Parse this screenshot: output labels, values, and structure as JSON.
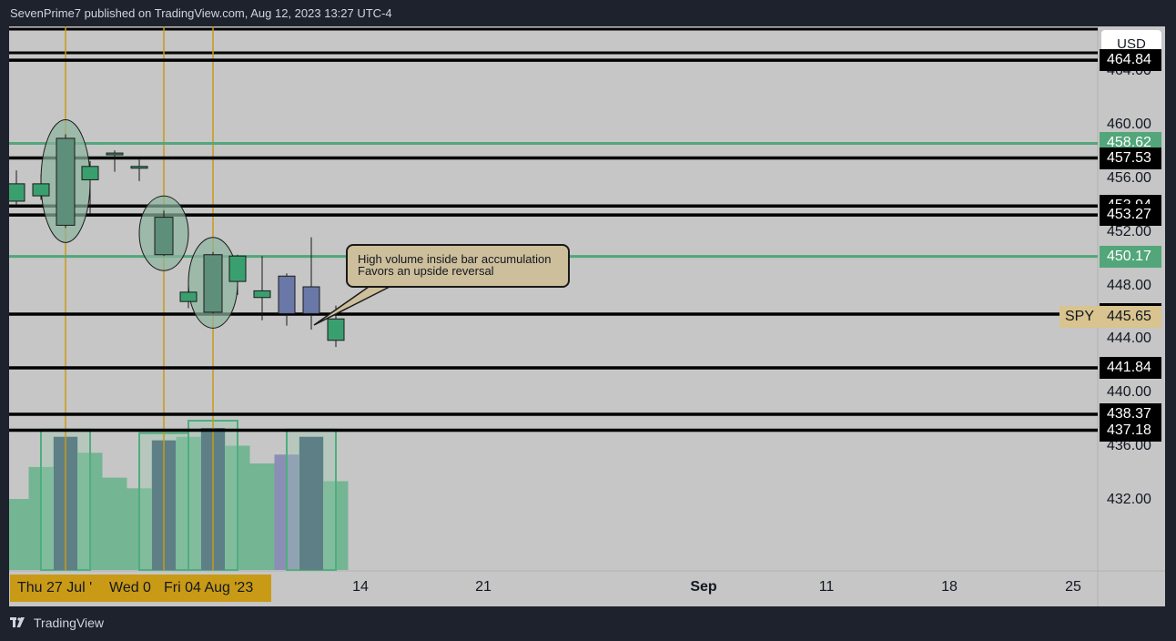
{
  "header": {
    "publisher_text": "SevenPrime7 published on TradingView.com, Aug 12, 2023 13:27 UTC-4"
  },
  "footer": {
    "brand": "TradingView",
    "logo_icon": "tradingview-logo-icon"
  },
  "toolbar": {
    "currency": "USD"
  },
  "annotation": {
    "line1": "High volume inside bar accumulation",
    "line2": "Favors an upside reversal"
  },
  "colors": {
    "background": "#c6c6c6",
    "up_candle": "#3a9f6e",
    "down_candle": "#6a78a8",
    "green_line": "#52a67a",
    "black_line": "#000000",
    "vertical_line": "#c99a16",
    "volume_up": "#5fb087",
    "volume_down": "#7c7fb0",
    "ellipse_fill": "#8cb49e",
    "symbol_tag": "#d9c48f",
    "date_badge": "#c99a16"
  },
  "chart_data": {
    "type": "candlestick",
    "symbol": "SPY",
    "currency": "USD",
    "ylim": [
      430,
      465.8
    ],
    "y_ticks": [
      "432.00",
      "436.00",
      "440.00",
      "444.00",
      "448.00",
      "452.00",
      "456.00",
      "460.00",
      "464.00"
    ],
    "x_tick_labels": [
      {
        "label": "14",
        "bold": false
      },
      {
        "label": "21",
        "bold": false
      },
      {
        "label": "Sep",
        "bold": true
      },
      {
        "label": "11",
        "bold": false
      },
      {
        "label": "18",
        "bold": false
      },
      {
        "label": "25",
        "bold": false
      }
    ],
    "date_badges": [
      "Thu 27 Jul '",
      "Wed 0",
      "Fri 04 Aug '23"
    ],
    "current_price": {
      "symbol": "SPY",
      "value": 445.65
    },
    "horizontal_levels": [
      {
        "value": 464.84,
        "color": "black",
        "label": "464.84"
      },
      {
        "value": 458.62,
        "color": "green",
        "label": "458.62"
      },
      {
        "value": 457.53,
        "color": "black",
        "label": "457.53"
      },
      {
        "value": 453.94,
        "color": "black",
        "label": "453.94"
      },
      {
        "value": 453.27,
        "color": "black",
        "label": "453.27"
      },
      {
        "value": 450.17,
        "color": "green",
        "label": "450.17"
      },
      {
        "value": 445.86,
        "color": "black",
        "label": "445.86"
      },
      {
        "value": 441.84,
        "color": "black",
        "label": "441.84"
      },
      {
        "value": 438.37,
        "color": "black",
        "label": "438.37"
      },
      {
        "value": 437.18,
        "color": "black",
        "label": "437.18"
      }
    ],
    "candles": [
      {
        "open": 454.3,
        "close": 455.6,
        "high": 456.6,
        "low": 453.9,
        "dir": "up"
      },
      {
        "open": 454.7,
        "close": 455.6,
        "high": 456.3,
        "low": 454.4,
        "dir": "up"
      },
      {
        "open": 452.5,
        "close": 459.0,
        "high": 459.3,
        "low": 452.3,
        "dir": "up"
      },
      {
        "open": 455.9,
        "close": 456.9,
        "high": 457.3,
        "low": 453.3,
        "dir": "up"
      },
      {
        "open": 457.8,
        "close": 457.9,
        "high": 458.1,
        "low": 456.5,
        "dir": "up"
      },
      {
        "open": 456.8,
        "close": 456.9,
        "high": 457.4,
        "low": 455.8,
        "dir": "up"
      },
      {
        "open": 450.3,
        "close": 453.1,
        "high": 453.6,
        "low": 450.2,
        "dir": "up"
      },
      {
        "open": 446.8,
        "close": 447.5,
        "high": 448.0,
        "low": 446.3,
        "dir": "up"
      },
      {
        "open": 446.0,
        "close": 450.3,
        "high": 450.5,
        "low": 445.9,
        "dir": "up"
      },
      {
        "open": 448.3,
        "close": 450.2,
        "high": 450.3,
        "low": 447.3,
        "dir": "up"
      },
      {
        "open": 447.1,
        "close": 447.6,
        "high": 450.2,
        "low": 445.4,
        "dir": "up"
      },
      {
        "open": 448.7,
        "close": 445.9,
        "high": 448.9,
        "low": 445.0,
        "dir": "down"
      },
      {
        "open": 447.9,
        "close": 445.9,
        "high": 451.6,
        "low": 444.7,
        "dir": "down"
      },
      {
        "open": 443.9,
        "close": 445.5,
        "high": 446.5,
        "low": 443.4,
        "dir": "up"
      }
    ],
    "volume": [
      40,
      58,
      75,
      66,
      52,
      46,
      73,
      75,
      80,
      70,
      60,
      65,
      75,
      50
    ],
    "volume_dir": [
      "up",
      "up",
      "up",
      "up",
      "up",
      "up",
      "up",
      "up",
      "up",
      "up",
      "up",
      "down",
      "up",
      "up"
    ],
    "highlighted_candles": [
      2,
      6,
      8
    ],
    "highlighted_volume": [
      2,
      6,
      8,
      12
    ],
    "vertical_marker_candles": [
      2,
      6,
      8
    ],
    "annotation_candle": 12
  }
}
